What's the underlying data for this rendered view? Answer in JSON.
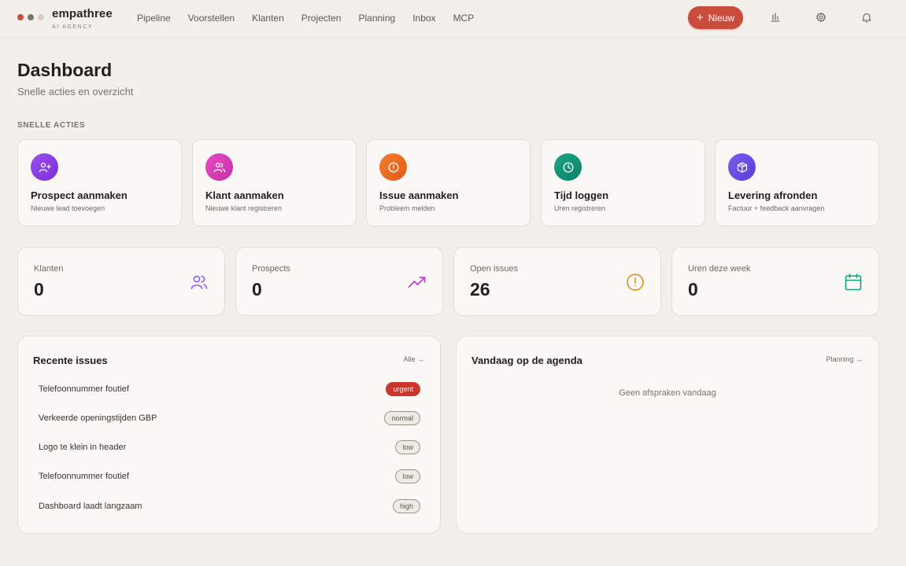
{
  "brand": {
    "name": "empathree",
    "tagline": "AI AGENCY",
    "dot_colors": [
      "#c94c3c",
      "#6f7a6a",
      "#d8cdbc"
    ]
  },
  "nav": [
    "Pipeline",
    "Voorstellen",
    "Klanten",
    "Projecten",
    "Planning",
    "Inbox",
    "MCP"
  ],
  "toolbar": {
    "new_label": "Nieuw",
    "icons": [
      "bar-chart-icon",
      "gear-icon",
      "bell-icon"
    ]
  },
  "header": {
    "title": "Dashboard",
    "subtitle": "Snelle acties en overzicht"
  },
  "quick_actions": {
    "label": "SNELLE ACTIES",
    "items": [
      {
        "title": "Prospect aanmaken",
        "desc": "Nieuwe lead toevoegen",
        "icon": "user-plus-icon",
        "color": "#8b3fe0"
      },
      {
        "title": "Klant aanmaken",
        "desc": "Nieuwe klant registreren",
        "icon": "users-icon",
        "color": "#d83cb5"
      },
      {
        "title": "Issue aanmaken",
        "desc": "Probleem melden",
        "icon": "alert-circle-icon",
        "color": "#ee6a24"
      },
      {
        "title": "Tijd loggen",
        "desc": "Uren registreren",
        "icon": "clock-icon",
        "color": "#13957a"
      },
      {
        "title": "Levering afronden",
        "desc": "Factuur + feedback aanvragen",
        "icon": "package-icon",
        "color": "#6a4ee0"
      }
    ]
  },
  "stats": [
    {
      "label": "Klanten",
      "value": "0",
      "icon": "users-icon",
      "color": "#8b5cf6"
    },
    {
      "label": "Prospects",
      "value": "0",
      "icon": "trending-up-icon",
      "color": "#c13bd9"
    },
    {
      "label": "Open issues",
      "value": "26",
      "icon": "alert-circle-icon",
      "color": "#e0952a"
    },
    {
      "label": "Uren deze week",
      "value": "0",
      "icon": "calendar-icon",
      "color": "#11a37f"
    }
  ],
  "recent_issues": {
    "title": "Recente issues",
    "link": "Alle →",
    "items": [
      {
        "title": "Telefoonnummer foutief",
        "priority": "urgent"
      },
      {
        "title": "Verkeerde openingstijden GBP",
        "priority": "normal"
      },
      {
        "title": "Logo te klein in header",
        "priority": "low"
      },
      {
        "title": "Telefoonnummer foutief",
        "priority": "low"
      },
      {
        "title": "Dashboard laadt langzaam",
        "priority": "high"
      }
    ]
  },
  "agenda": {
    "title": "Vandaag op de agenda",
    "link": "Planning →",
    "empty": "Geen afspraken vandaag"
  }
}
